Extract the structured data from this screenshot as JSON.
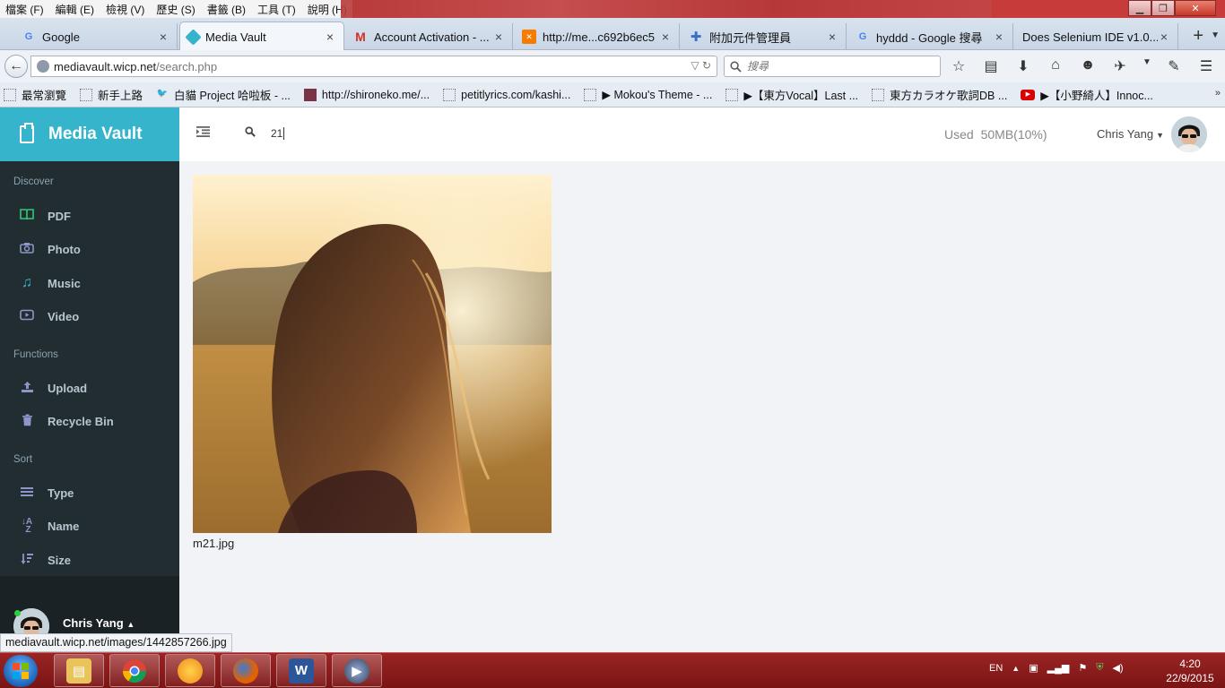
{
  "browser": {
    "menu": [
      "檔案 (F)",
      "編輯 (E)",
      "檢視 (V)",
      "歷史 (S)",
      "書籤 (B)",
      "工具 (T)",
      "說明 (H)"
    ],
    "tabs": [
      {
        "label": "Google",
        "icon": "google-icon",
        "color": "#4285f4"
      },
      {
        "label": "Media Vault",
        "icon": "cube-icon",
        "color": "#35b4cc"
      },
      {
        "label": "Account Activation - ...",
        "icon": "gmail-icon",
        "color": "#d93025"
      },
      {
        "label": "http://me...c692b6ec5",
        "icon": "xampp-icon",
        "color": "#f57c00"
      },
      {
        "label": "附加元件管理員",
        "icon": "puzzle-icon",
        "color": "#3a6fc7"
      },
      {
        "label": "hyddd - Google 搜尋",
        "icon": "google-icon",
        "color": "#4285f4"
      },
      {
        "label": "Does Selenium IDE v1.0....",
        "icon": "",
        "color": ""
      }
    ],
    "url_host": "mediavault.wicp.net",
    "url_path": "/search.php",
    "search_placeholder": "搜尋",
    "bookmarks": [
      {
        "label": "最常瀏覽",
        "icon": "page-icon"
      },
      {
        "label": "新手上路",
        "icon": "page-icon"
      },
      {
        "label": "白貓 Project 哈啦板 - ...",
        "icon": "bird-icon"
      },
      {
        "label": "http://shironeko.me/...",
        "icon": "image-icon"
      },
      {
        "label": "petitlyrics.com/kashi...",
        "icon": "page-icon"
      },
      {
        "label": "▶ Mokou's Theme - ...",
        "icon": "page-icon"
      },
      {
        "label": "▶【東方Vocal】Last ...",
        "icon": "page-icon"
      },
      {
        "label": "東方カラオケ歌詞DB ...",
        "icon": "page-icon"
      },
      {
        "label": "▶【小野綺人】Innoc...",
        "icon": "youtube-icon"
      }
    ],
    "status_url": "mediavault.wicp.net/images/1442857266.jpg"
  },
  "app": {
    "brand": "Media Vault",
    "search_value": "21",
    "usage_label": "Used",
    "usage_value": "50MB(10%)",
    "user": "Chris Yang",
    "sidebar": {
      "discover_heading": "Discover",
      "discover": [
        {
          "label": "PDF",
          "icon": "book-icon",
          "color": "#2ecc71"
        },
        {
          "label": "Photo",
          "icon": "camera-icon",
          "color": "#8e95c8"
        },
        {
          "label": "Music",
          "icon": "music-icon",
          "color": "#35b4cc"
        },
        {
          "label": "Video",
          "icon": "video-icon",
          "color": "#8e95c8"
        }
      ],
      "functions_heading": "Functions",
      "functions": [
        {
          "label": "Upload",
          "icon": "upload-icon",
          "color": "#8e95c8"
        },
        {
          "label": "Recycle Bin",
          "icon": "trash-icon",
          "color": "#8e95c8"
        }
      ],
      "sort_heading": "Sort",
      "sort": [
        {
          "label": "Type",
          "icon": "list-icon",
          "color": "#8e95c8"
        },
        {
          "label": "Name",
          "icon": "sort-alpha-icon",
          "color": "#8e95c8"
        },
        {
          "label": "Size",
          "icon": "sort-amount-icon",
          "color": "#8e95c8"
        }
      ]
    },
    "results": [
      {
        "filename": "m21.jpg"
      }
    ]
  },
  "taskbar": {
    "lang": "EN",
    "time": "4:20",
    "date": "22/9/2015"
  }
}
